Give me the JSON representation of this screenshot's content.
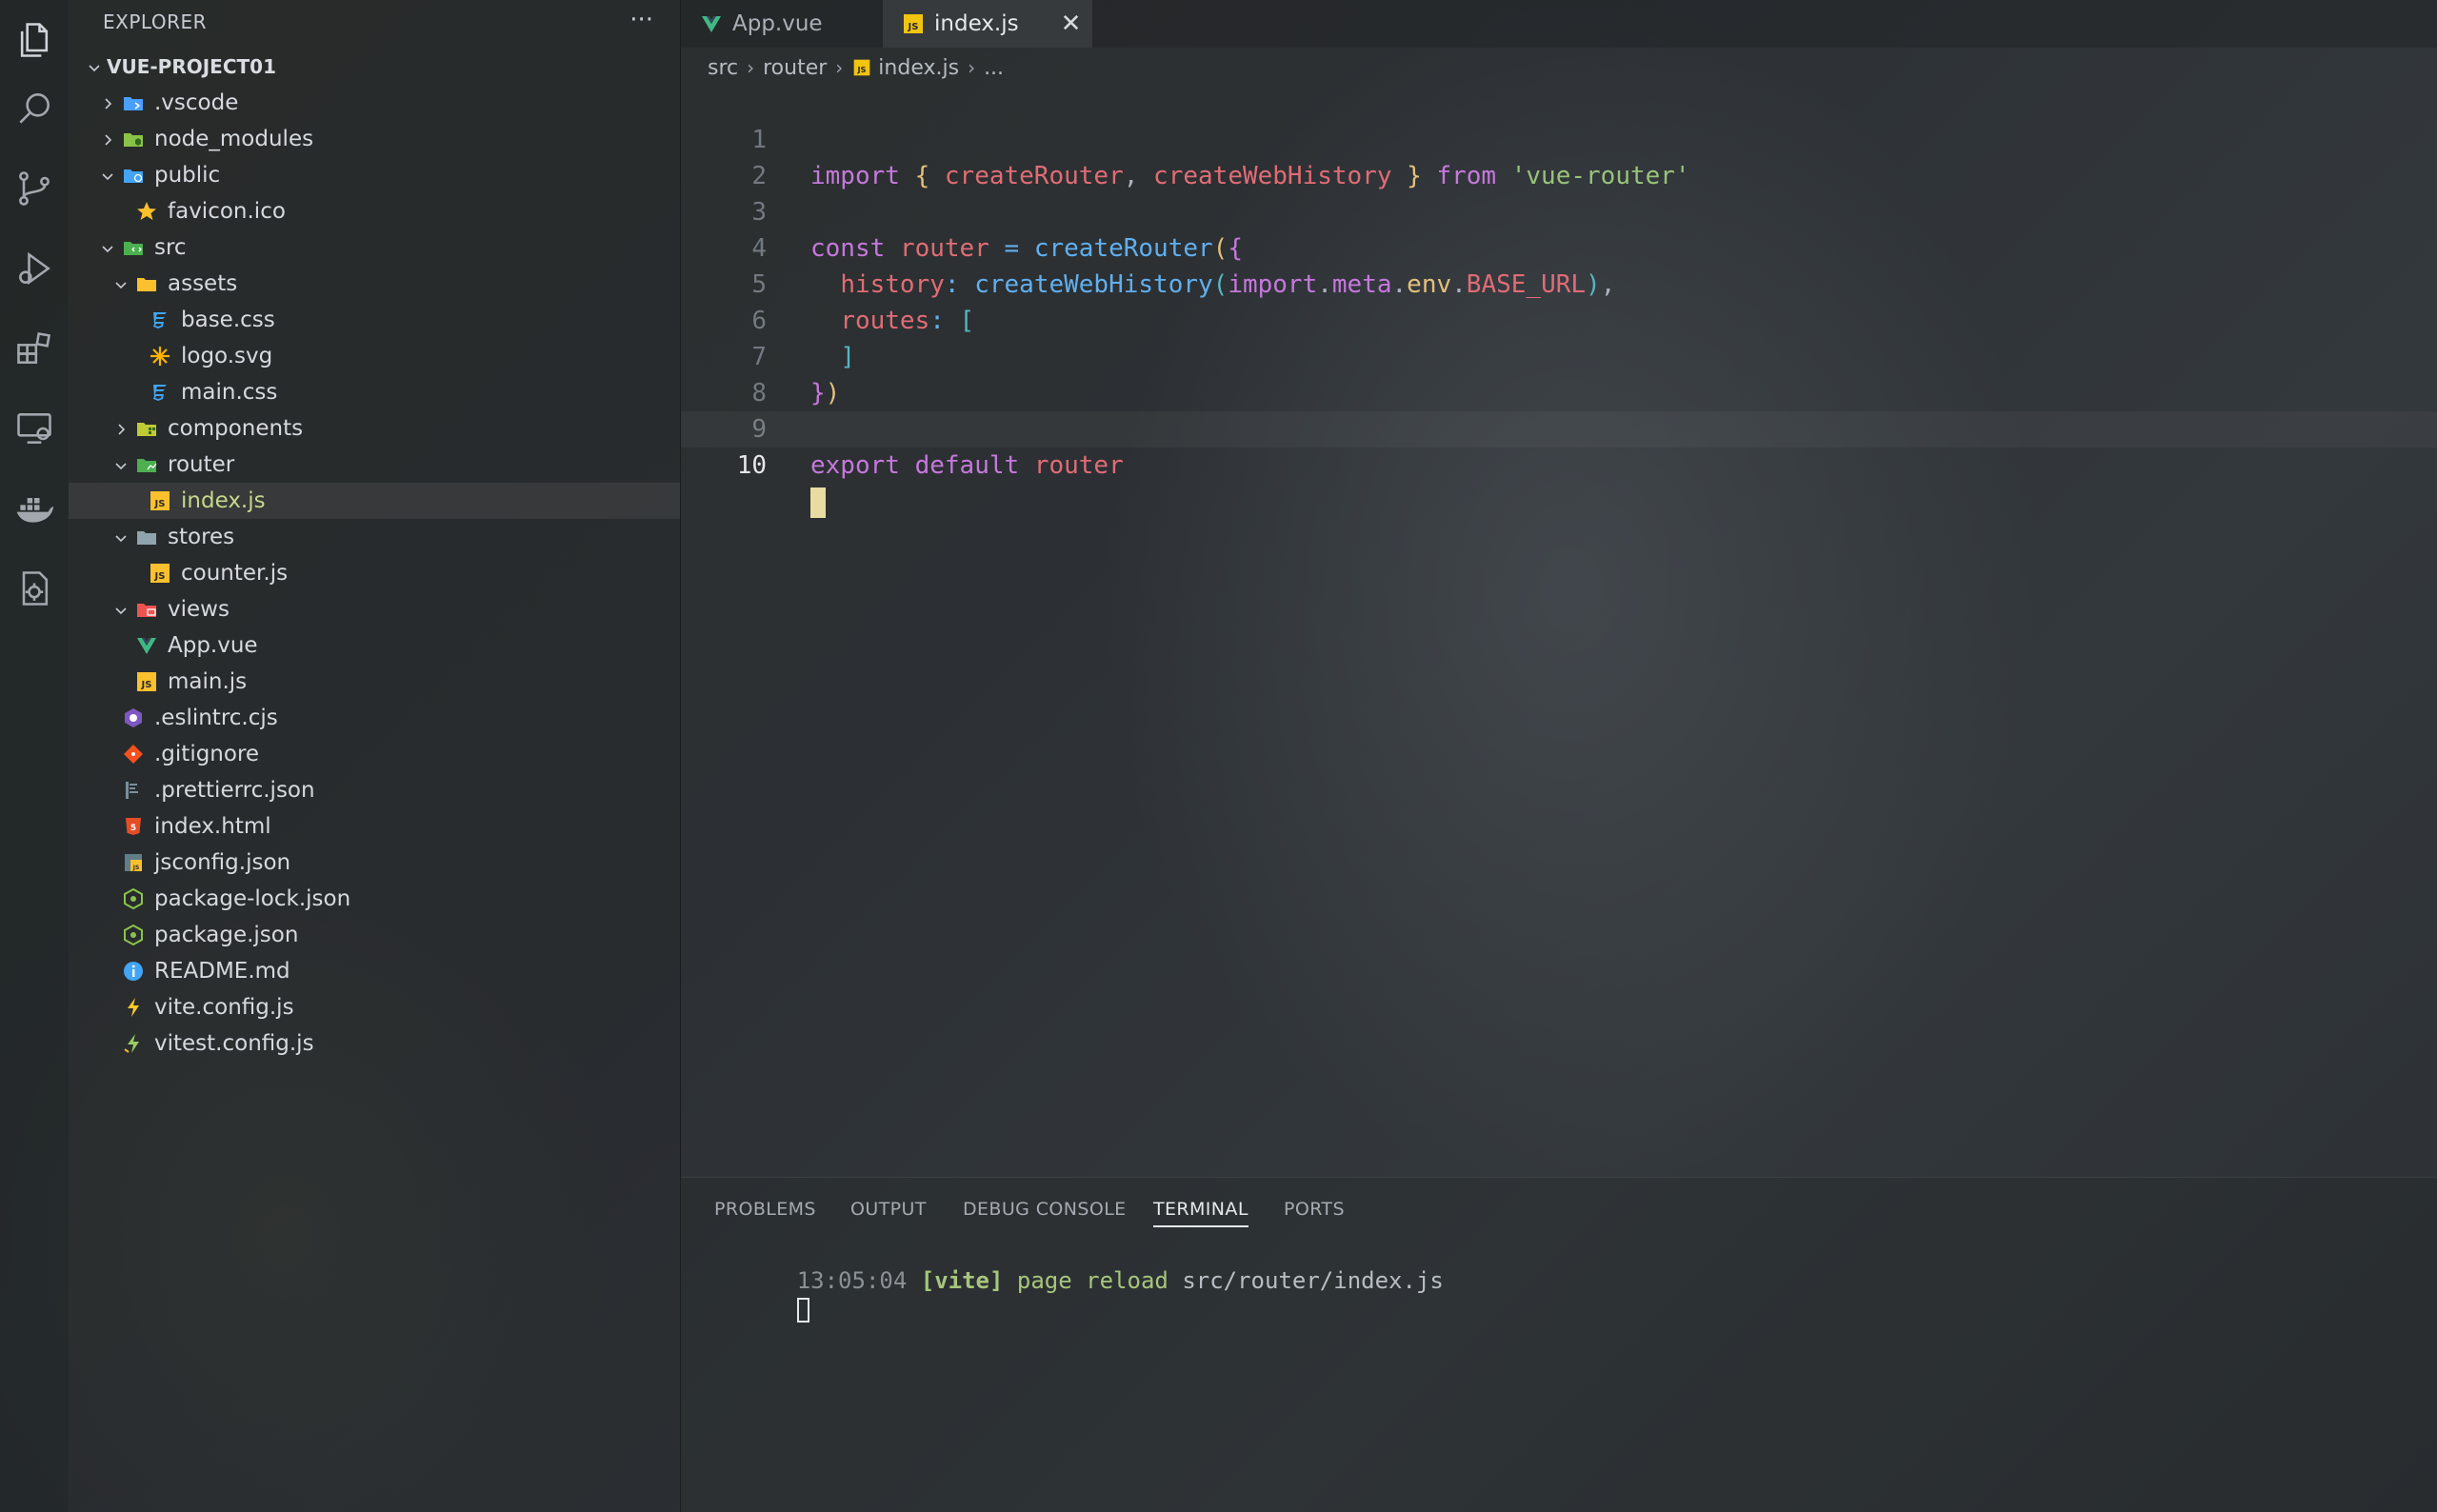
{
  "explorer": {
    "title": "EXPLORER",
    "more": "···",
    "project": "VUE-PROJECT01",
    "items": [
      {
        "label": ".vscode",
        "icon": "vscode-folder-icon",
        "chevron": "right",
        "color": "#4a9eff"
      },
      {
        "label": "node_modules",
        "icon": "node-folder-icon",
        "chevron": "right",
        "color": "#8bc34a"
      },
      {
        "label": "public",
        "icon": "public-folder-icon",
        "chevron": "down",
        "color": "#42a5f5"
      },
      {
        "label": "favicon.ico",
        "icon": "star-icon",
        "chevron": "",
        "color": "#fbc02d"
      },
      {
        "label": "src",
        "icon": "src-folder-icon",
        "chevron": "down",
        "color": "#4caf50"
      },
      {
        "label": "assets",
        "icon": "assets-folder-icon",
        "chevron": "down",
        "color": "#fbc02d"
      },
      {
        "label": "base.css",
        "icon": "css-icon",
        "chevron": "",
        "color": "#42a5f5"
      },
      {
        "label": "logo.svg",
        "icon": "svg-icon",
        "chevron": "",
        "color": "#ffb300"
      },
      {
        "label": "main.css",
        "icon": "css-icon",
        "chevron": "",
        "color": "#42a5f5"
      },
      {
        "label": "components",
        "icon": "components-folder-icon",
        "chevron": "right",
        "color": "#c0ca33"
      },
      {
        "label": "router",
        "icon": "router-folder-icon",
        "chevron": "down",
        "color": "#4caf50"
      },
      {
        "label": "index.js",
        "icon": "js-icon",
        "chevron": "",
        "color": "#fbc02d",
        "selected": true
      },
      {
        "label": "stores",
        "icon": "stores-folder-icon",
        "chevron": "down",
        "color": "#90a4ae"
      },
      {
        "label": "counter.js",
        "icon": "js-icon",
        "chevron": "",
        "color": "#fbc02d"
      },
      {
        "label": "views",
        "icon": "views-folder-icon",
        "chevron": "down",
        "color": "#ef5350"
      },
      {
        "label": "App.vue",
        "icon": "vue-icon",
        "chevron": "",
        "color": "#41b883"
      },
      {
        "label": "main.js",
        "icon": "js-icon",
        "chevron": "",
        "color": "#fbc02d"
      },
      {
        "label": ".eslintrc.cjs",
        "icon": "eslint-icon",
        "chevron": "",
        "color": "#7e57c2"
      },
      {
        "label": ".gitignore",
        "icon": "git-icon",
        "chevron": "",
        "color": "#f4511e"
      },
      {
        "label": ".prettierrc.json",
        "icon": "prettier-icon",
        "chevron": "",
        "color": "#78909c"
      },
      {
        "label": "index.html",
        "icon": "html-icon",
        "chevron": "",
        "color": "#e44d26"
      },
      {
        "label": "jsconfig.json",
        "icon": "jsconfig-icon",
        "chevron": "",
        "color": "#fbc02d"
      },
      {
        "label": "package-lock.json",
        "icon": "npm-icon",
        "chevron": "",
        "color": "#8bc34a"
      },
      {
        "label": "package.json",
        "icon": "npm-icon",
        "chevron": "",
        "color": "#8bc34a"
      },
      {
        "label": "README.md",
        "icon": "info-icon",
        "chevron": "",
        "color": "#42a5f5"
      },
      {
        "label": "vite.config.js",
        "icon": "vite-icon",
        "chevron": "",
        "color": "#ffca28"
      },
      {
        "label": "vitest.config.js",
        "icon": "vitest-icon",
        "chevron": "",
        "color": "#9ccc65"
      }
    ]
  },
  "tabs": [
    {
      "label": "App.vue",
      "icon": "vue-icon",
      "active": false
    },
    {
      "label": "index.js",
      "icon": "js-icon",
      "active": true,
      "close": "✕"
    }
  ],
  "breadcrumb": [
    "src",
    "router",
    "index.js",
    "..."
  ],
  "editor": {
    "current_line": 10,
    "lines": [
      {
        "n": "1"
      },
      {
        "n": "2"
      },
      {
        "n": "3"
      },
      {
        "n": "4"
      },
      {
        "n": "5"
      },
      {
        "n": "6"
      },
      {
        "n": "7"
      },
      {
        "n": "8"
      },
      {
        "n": "9"
      },
      {
        "n": "10"
      }
    ],
    "tokens": {
      "l1": [
        "import",
        " { ",
        "createRouter",
        ", ",
        "createWebHistory",
        " } ",
        "from",
        " ",
        "'vue-router'"
      ],
      "l3": [
        "const",
        " ",
        "router",
        " = ",
        "createRouter",
        "(",
        "{"
      ],
      "l4": [
        "  ",
        "history",
        ": ",
        "createWebHistory",
        "(",
        "import",
        ".",
        "meta",
        ".",
        "env",
        ".",
        "BASE_URL",
        ")",
        ","
      ],
      "l5": [
        "  ",
        "routes",
        ": ",
        "["
      ],
      "l6": [
        "  ",
        "]"
      ],
      "l7": [
        "}",
        ")"
      ],
      "l9": [
        "export",
        " ",
        "default",
        " ",
        "router"
      ]
    }
  },
  "panel": {
    "tabs": [
      "PROBLEMS",
      "OUTPUT",
      "DEBUG CONSOLE",
      "TERMINAL",
      "PORTS"
    ],
    "active_tab": "TERMINAL",
    "terminal": {
      "time": "13:05:04",
      "tag": "[vite]",
      "msg": "page reload",
      "path": "src/router/index.js"
    }
  },
  "activity_bar": [
    "explorer-icon",
    "search-icon",
    "source-control-icon",
    "run-debug-icon",
    "extensions-icon",
    "remote-explorer-icon",
    "docker-icon",
    "settings-sync-icon"
  ]
}
